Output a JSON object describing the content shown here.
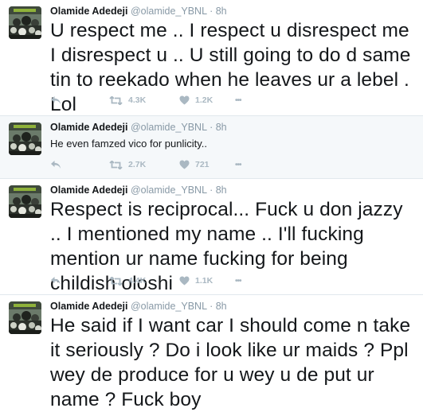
{
  "colors": {
    "name": "#14171a",
    "meta": "#8899a6",
    "action": "#aab8c2",
    "border": "#e1e8ed",
    "highlight_bg": "#f5f8fa"
  },
  "icons": {
    "reply": "reply-icon",
    "retweet": "retweet-icon",
    "like": "heart-icon",
    "more": "more-icon"
  },
  "tweets": [
    {
      "name": "Olamide Adedeji",
      "handle": "@olamide_YBNL",
      "dot": "·",
      "time": "8h",
      "text": "U respect me .. I respect u disrespect me I disrespect u .. U still going to do d same tin to reekado when he leaves ur a lebel . Lol",
      "retweets": "4.3K",
      "likes": "1.2K",
      "more": "•••"
    },
    {
      "name": "Olamide Adedeji",
      "handle": "@olamide_YBNL",
      "dot": "·",
      "time": "8h",
      "text": "He even famzed vico for punlicity..",
      "retweets": "2.7K",
      "likes": "721",
      "more": "•••"
    },
    {
      "name": "Olamide Adedeji",
      "handle": "@olamide_YBNL",
      "dot": "·",
      "time": "8h",
      "text": "Respect is reciprocal... Fuck u don jazzy .. I mentioned my name .. I'll fucking mention ur name fucking for being childish oloshi",
      "retweets": "4.4K",
      "likes": "1.1K",
      "more": "•••"
    },
    {
      "name": "Olamide Adedeji",
      "handle": "@olamide_YBNL",
      "dot": "·",
      "time": "8h",
      "text": "He said if I want car I should come n take it seriously ? Do i look like ur maids ? Ppl wey de produce for u wey u de put ur name ? Fuck boy",
      "retweets": "",
      "likes": "",
      "more": ""
    }
  ]
}
